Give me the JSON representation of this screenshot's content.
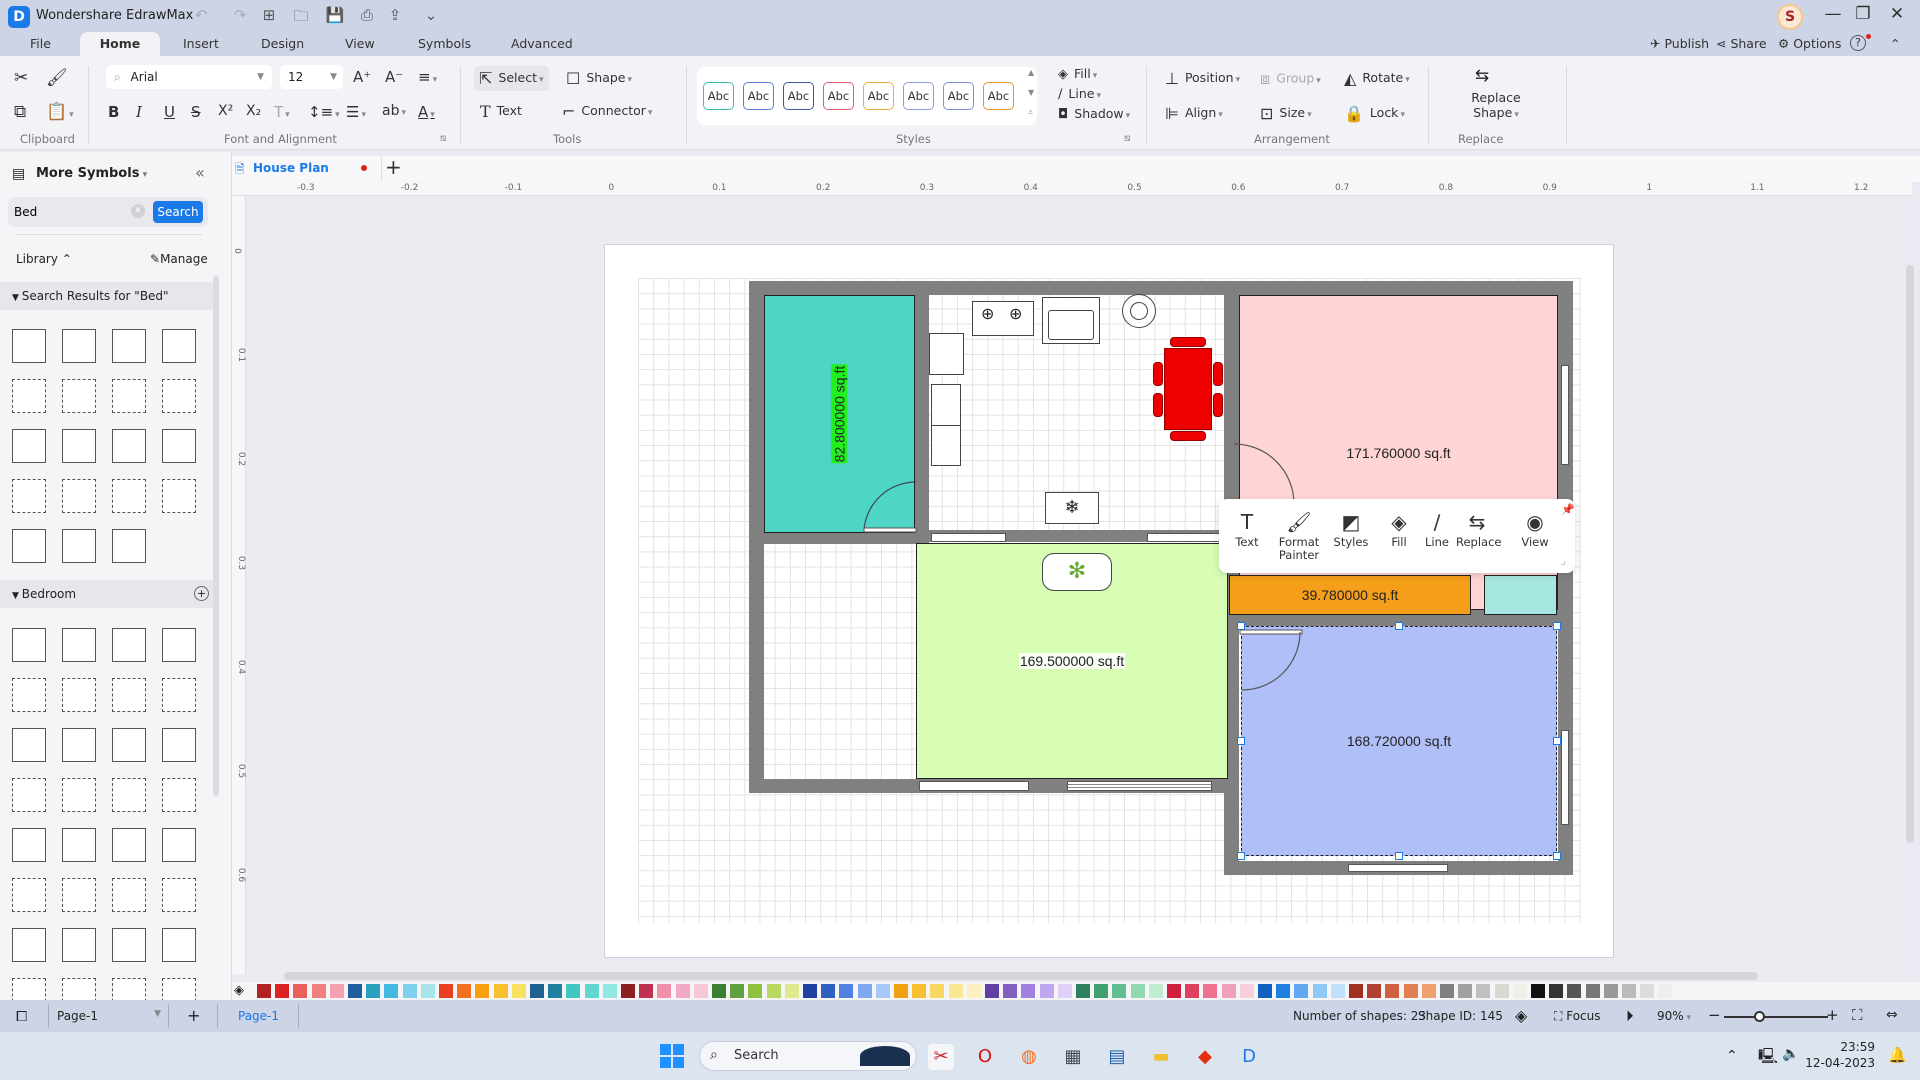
{
  "app": {
    "title": "Wondershare EdrawMax",
    "logo_glyph": "D"
  },
  "quick_access": [
    {
      "name": "undo-icon",
      "glyph": "↶"
    },
    {
      "name": "redo-icon",
      "glyph": "↷"
    },
    {
      "name": "new-icon",
      "glyph": "⊞"
    },
    {
      "name": "open-icon",
      "glyph": "🗀"
    },
    {
      "name": "save-icon",
      "glyph": "💾"
    },
    {
      "name": "print-icon",
      "glyph": "⎙"
    },
    {
      "name": "export-icon",
      "glyph": "⇪"
    },
    {
      "name": "customize-icon",
      "glyph": "⌄"
    }
  ],
  "user": {
    "avatar_letter": "S"
  },
  "window": {
    "minimize": "—",
    "restore": "❐",
    "close": "✕"
  },
  "menu_tabs": [
    "File",
    "Home",
    "Insert",
    "Design",
    "View",
    "Symbols",
    "Advanced"
  ],
  "active_tab": "Home",
  "top_right": {
    "publish": "Publish",
    "share": "Share",
    "options": "Options",
    "help": "?"
  },
  "ribbon": {
    "clipboard": {
      "label": "Clipboard"
    },
    "font": {
      "family": "Arial",
      "size": "12",
      "label": "Font and Alignment"
    },
    "tools": {
      "select": "Select",
      "shape": "Shape",
      "text": "Text",
      "connector": "Connector",
      "label": "Tools"
    },
    "styles": {
      "samples": [
        "Abc",
        "Abc",
        "Abc",
        "Abc",
        "Abc",
        "Abc",
        "Abc",
        "Abc"
      ],
      "colors": [
        "#3dbfb0",
        "#5b7bd5",
        "#3d5a9e",
        "#e06070",
        "#e8b040",
        "#8a9bd8",
        "#7a92d8",
        "#e8902a"
      ],
      "label": "Styles"
    },
    "fill": "Fill",
    "line": "Line",
    "shadow": "Shadow",
    "arrangement": {
      "position": "Position",
      "group": "Group",
      "rotate": "Rotate",
      "align": "Align",
      "size": "Size",
      "lock": "Lock",
      "label": "Arrangement"
    },
    "replace": {
      "button": "Replace Shape",
      "label": "Replace"
    }
  },
  "left_panel": {
    "title": "More Symbols",
    "search_value": "Bed",
    "search_button": "Search",
    "library": "Library",
    "manage": "Manage",
    "search_results_header": "Search Results for  \"Bed\"",
    "bedroom_header": "Bedroom"
  },
  "document": {
    "tab_name": "House Plan",
    "add_tab": "+"
  },
  "ruler": {
    "horizontal": [
      "-0.3",
      "-0.2",
      "-0.1",
      "0",
      "0.1",
      "0.2",
      "0.3",
      "0.4",
      "0.5",
      "0.6",
      "0.7",
      "0.8",
      "0.9",
      "1",
      "1.1",
      "1.2"
    ],
    "vertical": [
      "0",
      "0.1",
      "0.2",
      "0.3",
      "0.4",
      "0.5",
      "0.6"
    ]
  },
  "floor_plan": {
    "rooms": [
      {
        "id": "teal-room",
        "label": "82.800000 sq.ft",
        "color": "#4dd5c5"
      },
      {
        "id": "pink-room",
        "label": "171.760000 sq.ft",
        "color": "#ffd4d4"
      },
      {
        "id": "green-room",
        "label": "169.500000 sq.ft",
        "color": "#d8fdb4"
      },
      {
        "id": "orange-room",
        "label": "39.780000 sq.ft",
        "color": "#f59e1a"
      },
      {
        "id": "blue-room",
        "label": "168.720000 sq.ft",
        "color": "#b0bff8"
      },
      {
        "id": "cyan-room",
        "label": "",
        "color": "#a6e6e0"
      }
    ],
    "dining_table_color": "#ee0000"
  },
  "floating_toolbar": [
    {
      "label": "Text",
      "glyph": "T",
      "name": "text-icon"
    },
    {
      "label": "Format Painter",
      "glyph": "🖌",
      "name": "format-painter-icon"
    },
    {
      "label": "Styles",
      "glyph": "◩",
      "name": "styles-icon"
    },
    {
      "label": "Fill",
      "glyph": "◈",
      "name": "fill-icon"
    },
    {
      "label": "Line",
      "glyph": "∕",
      "name": "line-icon"
    },
    {
      "label": "Replace",
      "glyph": "⇆",
      "name": "replace-icon"
    },
    {
      "label": "View",
      "glyph": "◉",
      "name": "view-icon"
    }
  ],
  "palette": [
    "#b22222",
    "#dd2222",
    "#e8605a",
    "#f08080",
    "#f4a0b0",
    "#1f5fa0",
    "#2aa0c0",
    "#44b8e0",
    "#7ed0ec",
    "#a8e4ec",
    "#e84020",
    "#f07020",
    "#f8a010",
    "#f8c030",
    "#f8e060",
    "#1e6090",
    "#2080a0",
    "#40c8c0",
    "#60d8d0",
    "#90e8e0",
    "#8b2020",
    "#c03050",
    "#f090a8",
    "#f4a8c8",
    "#f8c8d8",
    "#3a8030",
    "#60a040",
    "#90c040",
    "#b8d860",
    "#e0e890",
    "#2040a0",
    "#3060c0",
    "#5080e0",
    "#80a8f0",
    "#a8c8f8",
    "#f0a010",
    "#f8c030",
    "#f8d860",
    "#f8e890",
    "#fcf0c0",
    "#6040a0",
    "#8060c0",
    "#a080e0",
    "#c0a8f0",
    "#e0d0f8",
    "#308060",
    "#40a070",
    "#60c090",
    "#90d8b0",
    "#c0ecd0",
    "#d02040",
    "#e04060",
    "#f07090",
    "#f0a0b8",
    "#f8d0dc",
    "#1060c0",
    "#2080e0",
    "#60a8f0",
    "#90c8f8",
    "#c0e0fc",
    "#a03020",
    "#b04030",
    "#d06040",
    "#e08050",
    "#f0a070",
    "#808080",
    "#a0a0a0",
    "#c0c0c0",
    "#d8d8d0",
    "#f0f0e8",
    "#111111",
    "#333333",
    "#555555",
    "#777777",
    "#999999",
    "#bbbbbb",
    "#dddddd",
    "#eeeeee"
  ],
  "status": {
    "page_select": "Page-1",
    "add_page": "+",
    "active_page": "Page-1",
    "shape_count": "Number of shapes: 23",
    "shape_id": "Shape ID: 145",
    "focus": "Focus",
    "zoom": "90%",
    "zoom_fraction": 0.35
  },
  "taskbar": {
    "search_placeholder": "Search",
    "apps": [
      {
        "name": "snipping-tool-icon",
        "glyph": "✂",
        "color": "#d02020"
      },
      {
        "name": "opera-icon",
        "glyph": "O",
        "color": "#e01010"
      },
      {
        "name": "firefox-icon",
        "glyph": "◍",
        "color": "#f07020"
      },
      {
        "name": "calculator-icon",
        "glyph": "▦",
        "color": "#404850"
      },
      {
        "name": "notepad-icon",
        "glyph": "▤",
        "color": "#2060b0"
      },
      {
        "name": "file-explorer-icon",
        "glyph": "▬",
        "color": "#f0c030"
      },
      {
        "name": "brave-icon",
        "glyph": "◆",
        "color": "#e03010"
      },
      {
        "name": "edrawmax-taskbar-icon",
        "glyph": "D",
        "color": "#1a7ae8"
      }
    ],
    "time": "23:59",
    "date": "12-04-2023"
  }
}
